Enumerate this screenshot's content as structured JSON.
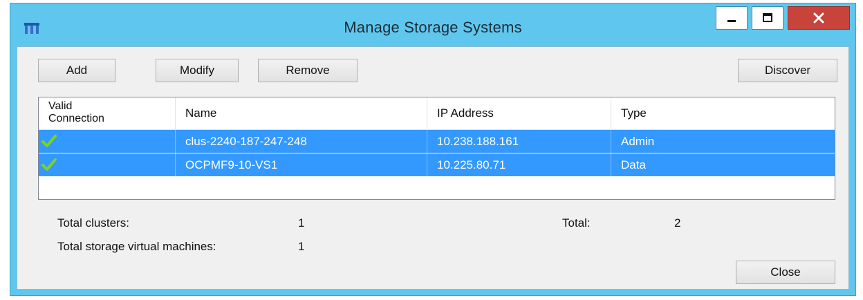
{
  "window": {
    "title": "Manage Storage Systems",
    "accent_color": "#5fc7ee",
    "close_color": "#c8433a"
  },
  "toolbar": {
    "add_label": "Add",
    "modify_label": "Modify",
    "remove_label": "Remove",
    "discover_label": "Discover"
  },
  "table": {
    "columns": [
      "Valid Connection",
      "Name",
      "IP Address",
      "Type"
    ],
    "valid_header_line1": "Valid",
    "valid_header_line2": "Connection",
    "selection_color": "#3399ff",
    "rows": [
      {
        "valid": "check-icon",
        "name": "clus-2240-187-247-248",
        "ip": "10.238.188.161",
        "type": "Admin"
      },
      {
        "valid": "check-icon",
        "name": "OCPMF9-10-VS1",
        "ip": "10.225.80.71",
        "type": "Data"
      }
    ]
  },
  "summary": {
    "total_clusters_label": "Total clusters:",
    "total_clusters_value": "1",
    "total_svms_label": "Total storage virtual machines:",
    "total_svms_value": "1",
    "total_label": "Total:",
    "total_value": "2"
  },
  "footer": {
    "close_label": "Close"
  }
}
